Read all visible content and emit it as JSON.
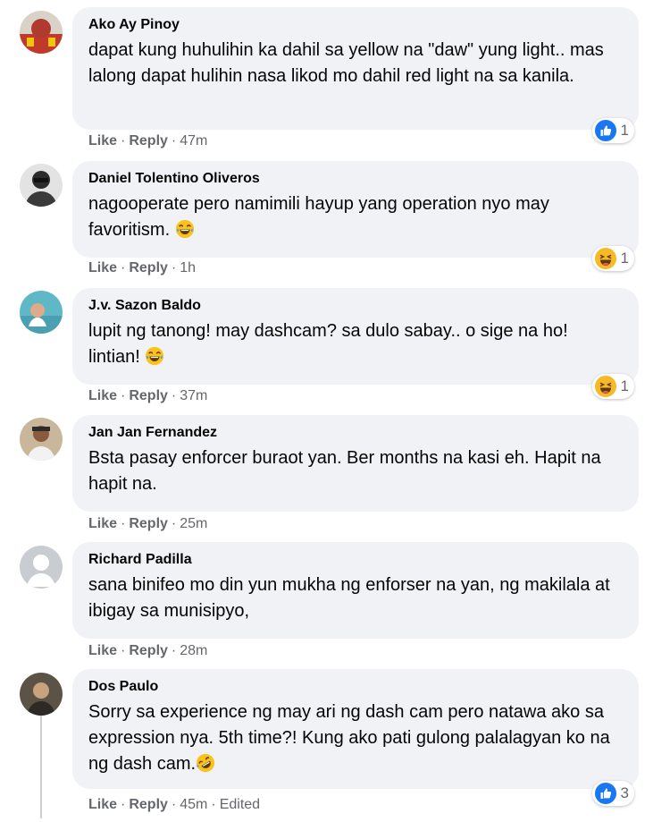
{
  "comments": [
    {
      "author": "Ako Ay Pinoy",
      "text": "dapat kung huhulihin ka dahil sa yellow na \"daw\" yung light.. mas lalong dapat hulihin nasa likod mo dahil red light na sa kanila.",
      "like": "Like",
      "reply": "Reply",
      "time": "47m",
      "reaction": {
        "icon": "like-icon",
        "count": "1"
      }
    },
    {
      "author": "Daniel Tolentino Oliveros",
      "text": "nagooperate pero namimili hayup yang operation nyo may favoritism.",
      "like": "Like",
      "reply": "Reply",
      "time": "1h",
      "reaction": {
        "icon": "haha-icon",
        "count": "1"
      }
    },
    {
      "author": "J.v. Sazon Baldo",
      "text": "lupit ng tanong! may dashcam? sa dulo sabay.. o sige na ho! lintian!",
      "like": "Like",
      "reply": "Reply",
      "time": "37m",
      "reaction": {
        "icon": "haha-icon",
        "count": "1"
      }
    },
    {
      "author": "Jan Jan Fernandez",
      "text": "Bsta pasay enforcer buraot yan. Ber months na kasi eh. Hapit na hapit na.",
      "like": "Like",
      "reply": "Reply",
      "time": "25m"
    },
    {
      "author": "Richard Padilla",
      "text": "sana binifeo mo din yun mukha ng enforser na yan, ng makilala at ibigay sa munisipyo,",
      "like": "Like",
      "reply": "Reply",
      "time": "28m"
    },
    {
      "author": "Dos Paulo",
      "text": "Sorry sa experience ng may ari ng dash cam pero natawa ako sa expression nya. 5th time?! Kung ako pati gulong palalagyan ko na ng dash cam.",
      "like": "Like",
      "reply": "Reply",
      "time": "45m",
      "edited": "Edited",
      "reaction": {
        "icon": "like-icon",
        "count": "3"
      }
    }
  ],
  "colors": {
    "bubble": "#f0f2f5",
    "meta": "#65676b",
    "like_blue": "#1877f2",
    "haha_yellow": "#f7b928"
  }
}
